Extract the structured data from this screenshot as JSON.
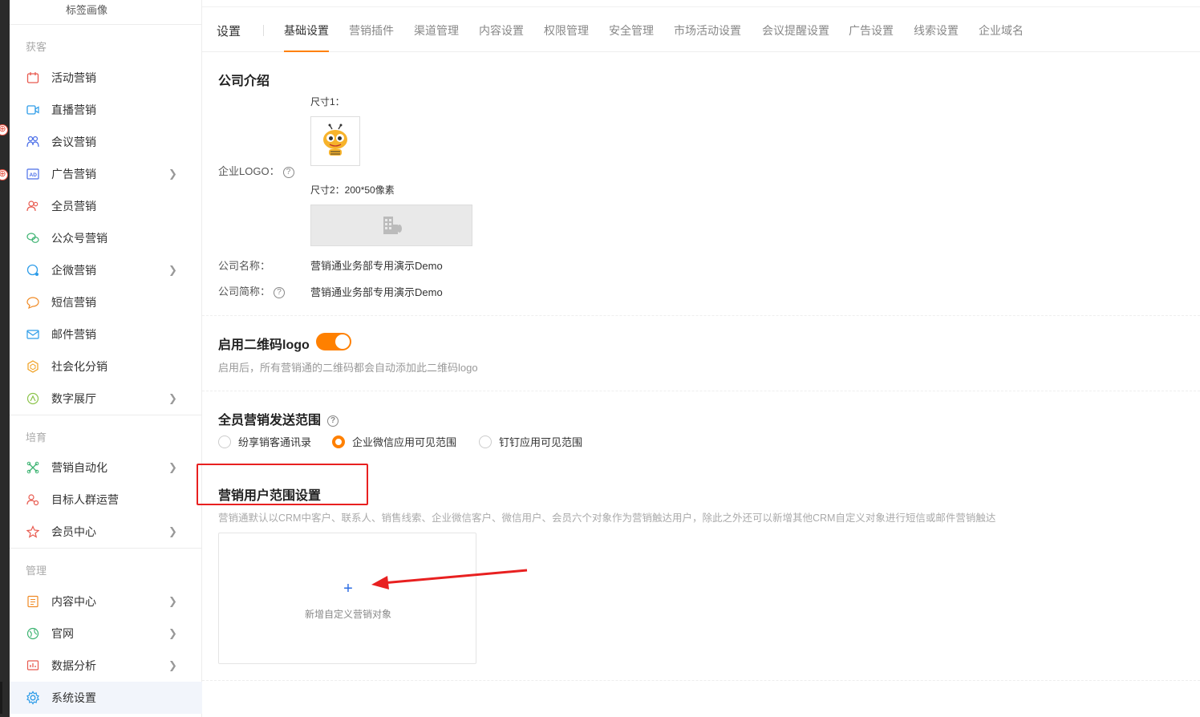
{
  "sidebar": {
    "top_label": "标签画像",
    "groups": {
      "acquire": "获客",
      "nurture": "培育",
      "manage": "管理"
    },
    "items": [
      {
        "label": "活动营销",
        "icon": "calendar-icon"
      },
      {
        "label": "直播营销",
        "icon": "video-icon"
      },
      {
        "label": "会议营销",
        "icon": "meeting-icon"
      },
      {
        "label": "广告营销",
        "icon": "ad-icon"
      },
      {
        "label": "全员营销",
        "icon": "people-icon"
      },
      {
        "label": "公众号营销",
        "icon": "wechat-icon"
      },
      {
        "label": "企微营销",
        "icon": "chat-icon"
      },
      {
        "label": "短信营销",
        "icon": "sms-icon"
      },
      {
        "label": "邮件营销",
        "icon": "mail-icon"
      },
      {
        "label": "社会化分销",
        "icon": "share-icon"
      },
      {
        "label": "数字展厅",
        "icon": "showroom-icon"
      },
      {
        "label": "营销自动化",
        "icon": "automation-icon"
      },
      {
        "label": "目标人群运营",
        "icon": "target-icon"
      },
      {
        "label": "会员中心",
        "icon": "member-icon"
      },
      {
        "label": "内容中心",
        "icon": "content-icon"
      },
      {
        "label": "官网",
        "icon": "website-icon"
      },
      {
        "label": "数据分析",
        "icon": "chart-icon"
      },
      {
        "label": "系统设置",
        "icon": "gear-icon"
      }
    ]
  },
  "header": {
    "title": "设置",
    "tabs": [
      "基础设置",
      "营销插件",
      "渠道管理",
      "内容设置",
      "权限管理",
      "安全管理",
      "市场活动设置",
      "会议提醒设置",
      "广告设置",
      "线索设置",
      "企业域名"
    ],
    "active_tab": "基础设置"
  },
  "company": {
    "heading": "公司介绍",
    "logo_label": "企业LOGO：",
    "size1_label": "尺寸1：",
    "size2_label": "尺寸2：200*50像素",
    "name_label": "公司名称：",
    "name_value": "营销通业务部专用演示Demo",
    "short_label": "公司简称：",
    "short_value": "营销通业务部专用演示Demo"
  },
  "qrcode": {
    "heading": "启用二维码logo",
    "enabled": true,
    "desc": "启用后，所有营销通的二维码都会自动添加此二维码logo"
  },
  "scope": {
    "heading": "全员营销发送范围",
    "options": [
      "纷享销客通讯录",
      "企业微信应用可见范围",
      "钉钉应用可见范围"
    ],
    "selected": "企业微信应用可见范围"
  },
  "user_scope": {
    "heading": "营销用户范围设置",
    "desc": "营销通默认以CRM中客户、联系人、销售线索、企业微信客户、微信用户、会员六个对象作为营销触达用户，除此之外还可以新增其他CRM自定义对象进行短信或邮件营销触达",
    "add_label": "新增自定义营销对象",
    "add_symbol": "+"
  },
  "colors": {
    "accent": "#ff8000",
    "link": "#2d6de3",
    "highlight": "#e82020"
  }
}
